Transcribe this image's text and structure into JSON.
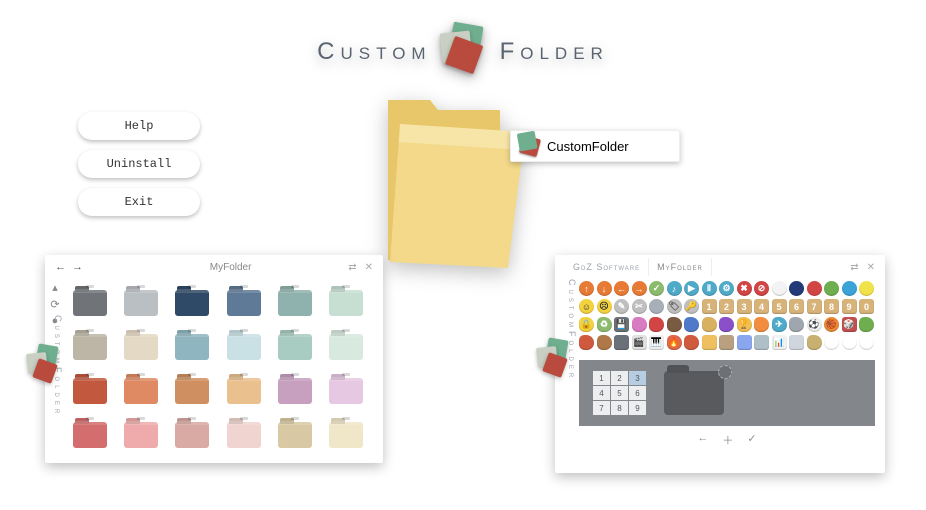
{
  "app": {
    "name_left": "Custom",
    "name_right": "Folder"
  },
  "menu": {
    "help": "Help",
    "uninstall": "Uninstall",
    "exit": "Exit"
  },
  "context_menu": {
    "label": "CustomFolder"
  },
  "palette_panel": {
    "title": "MyFolder",
    "brand_vertical": "CustomFolder",
    "folders": [
      "#707478",
      "#babfc4",
      "#2f4a66",
      "#5f7a96",
      "#90b2ae",
      "#c7ded3",
      "#bdb6a6",
      "#e4d9c4",
      "#8fb6c0",
      "#c9e0e5",
      "#a8ccc2",
      "#d8e9df",
      "#c2583d",
      "#e08a63",
      "#cf8f60",
      "#e9c08e",
      "#c79fbf",
      "#e6c8e2",
      "#d46d6d",
      "#efabab",
      "#d9a9a3",
      "#f0d4cf",
      "#d8c9a4",
      "#f0e6c8"
    ]
  },
  "emblem_panel": {
    "tabs": [
      "GdZ Software",
      "MyFolder"
    ],
    "active_tab": 1,
    "brand_vertical": "CustomFolder",
    "emblems_row1": [
      {
        "c": "#e77b35",
        "t": "↑"
      },
      {
        "c": "#e77b35",
        "t": "↓"
      },
      {
        "c": "#e77b35",
        "t": "←"
      },
      {
        "c": "#e77b35",
        "t": "→"
      },
      {
        "c": "#8dbb6e",
        "t": "✓"
      },
      {
        "c": "#4fa9c9",
        "t": "♪"
      },
      {
        "c": "#4fa9c9",
        "t": "▶"
      },
      {
        "c": "#4fa9c9",
        "t": "Ⅱ"
      },
      {
        "c": "#4fa9c9",
        "t": "⚙"
      },
      {
        "c": "#d24545",
        "t": "✖"
      },
      {
        "c": "#d24545",
        "t": "⊘"
      },
      {
        "c": "#f3f3f3",
        "t": "",
        "fg": "#666"
      },
      {
        "c": "#233a78",
        "t": ""
      },
      {
        "c": "#d24545",
        "t": ""
      },
      {
        "c": "#6fae4f",
        "t": ""
      },
      {
        "c": "#3aa3d8",
        "t": ""
      },
      {
        "c": "#f2e24a",
        "t": ""
      }
    ],
    "emblems_row2": [
      {
        "c": "#f2d23e",
        "t": "☺",
        "fg": "#333"
      },
      {
        "c": "#f2d23e",
        "t": "☹",
        "fg": "#333"
      },
      {
        "c": "#bfbfbf",
        "t": "✎"
      },
      {
        "c": "#bfbfbf",
        "t": "✂"
      },
      {
        "c": "#a7b0b8",
        "t": ""
      },
      {
        "c": "#bfbfbf",
        "t": "🏷",
        "fg": "#555"
      },
      {
        "c": "#bfbfbf",
        "t": "🔑",
        "fg": "#555"
      },
      {
        "c": "#d7b37a",
        "t": "1",
        "s": "sqr"
      },
      {
        "c": "#d7b37a",
        "t": "2",
        "s": "sqr"
      },
      {
        "c": "#d7b37a",
        "t": "3",
        "s": "sqr"
      },
      {
        "c": "#d7b37a",
        "t": "4",
        "s": "sqr"
      },
      {
        "c": "#d7b37a",
        "t": "5",
        "s": "sqr"
      },
      {
        "c": "#d7b37a",
        "t": "6",
        "s": "sqr"
      },
      {
        "c": "#d7b37a",
        "t": "7",
        "s": "sqr"
      },
      {
        "c": "#d7b37a",
        "t": "8",
        "s": "sqr"
      },
      {
        "c": "#d7b37a",
        "t": "9",
        "s": "sqr"
      },
      {
        "c": "#d7b37a",
        "t": "0",
        "s": "sqr"
      }
    ],
    "emblems_row3": [
      {
        "c": "#f2d23e",
        "t": "🔒",
        "fg": "#555",
        "s": "blob"
      },
      {
        "c": "#8dbb6e",
        "t": "♻",
        "s": "blob"
      },
      {
        "c": "#6b7178",
        "t": "💾",
        "s": "sqr"
      },
      {
        "c": "#d87bc0",
        "t": "",
        "s": "blob"
      },
      {
        "c": "#d24545",
        "t": "",
        "s": "blob"
      },
      {
        "c": "#7a5a40",
        "t": "",
        "s": "blob"
      },
      {
        "c": "#4f7ac9",
        "t": "",
        "s": "blob"
      },
      {
        "c": "#d8b060",
        "t": "",
        "s": "blob"
      },
      {
        "c": "#8a4fc9",
        "t": "",
        "s": "blob"
      },
      {
        "c": "#efbf53",
        "t": "🏆",
        "s": "blob"
      },
      {
        "c": "#f28c3e",
        "t": "",
        "s": "blob"
      },
      {
        "c": "#4fa9c9",
        "t": "✈",
        "s": "blob"
      },
      {
        "c": "#a0a6ad",
        "t": "",
        "s": "blob"
      },
      {
        "c": "#efefef",
        "t": "⚽",
        "fg": "#333"
      },
      {
        "c": "#e78b35",
        "t": "🏀"
      },
      {
        "c": "#c24f4f",
        "t": "🎲",
        "s": "sqr"
      },
      {
        "c": "#6fae4f",
        "t": "",
        "s": "blob"
      }
    ],
    "emblems_row4": [
      {
        "c": "#cf5a3e",
        "t": "",
        "s": "blob"
      },
      {
        "c": "#b07848",
        "t": "",
        "s": "blob"
      },
      {
        "c": "#6b7178",
        "t": "",
        "s": "sqr"
      },
      {
        "c": "#e2e2e2",
        "t": "🎬",
        "fg": "#333",
        "s": "sqr"
      },
      {
        "c": "#efefef",
        "t": "🎹",
        "fg": "#333",
        "s": "sqr"
      },
      {
        "c": "#e06848",
        "t": "🔥",
        "s": "blob"
      },
      {
        "c": "#cf5a3e",
        "t": "",
        "s": "blob"
      },
      {
        "c": "#efc060",
        "t": "",
        "s": "sqr"
      },
      {
        "c": "#b8a080",
        "t": "",
        "s": "sqr"
      },
      {
        "c": "#8aa6ef",
        "t": "",
        "s": "sqr"
      },
      {
        "c": "#aebfc8",
        "t": "",
        "s": "sqr"
      },
      {
        "c": "#f2f2f2",
        "t": "📊",
        "fg": "#555",
        "s": "sqr"
      },
      {
        "c": "#d0d6de",
        "t": "",
        "s": "sqr"
      },
      {
        "c": "#c8b070",
        "t": "",
        "s": "blob"
      },
      {
        "c": "#ffffff",
        "t": ""
      },
      {
        "c": "#ffffff",
        "t": ""
      },
      {
        "c": "#ffffff",
        "t": ""
      }
    ],
    "keypad": [
      "1",
      "2",
      "3",
      "4",
      "5",
      "6",
      "7",
      "8",
      "9"
    ],
    "keypad_selected": 2
  }
}
